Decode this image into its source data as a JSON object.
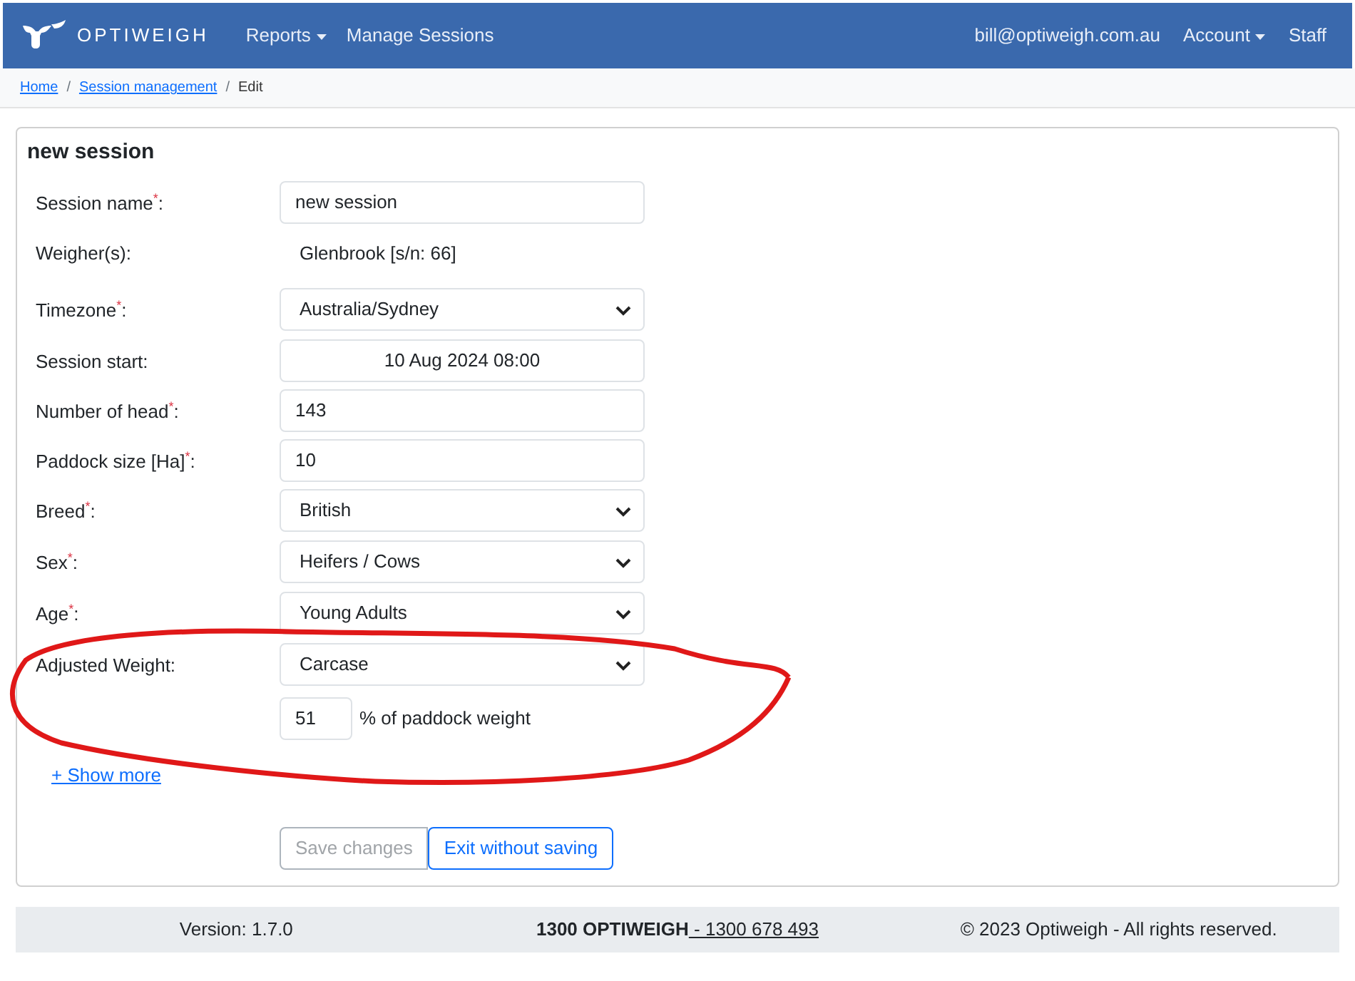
{
  "navbar": {
    "brand": "OPTIWEIGH",
    "left": [
      {
        "label": "Reports",
        "dropdown": true
      },
      {
        "label": "Manage Sessions",
        "dropdown": false
      }
    ],
    "right": [
      {
        "label": "bill@optiweigh.com.au",
        "dropdown": false
      },
      {
        "label": "Account",
        "dropdown": true
      },
      {
        "label": "Staff",
        "dropdown": false
      }
    ]
  },
  "breadcrumb": [
    {
      "kind": "link",
      "label": "Home"
    },
    {
      "kind": "separator",
      "label": "/"
    },
    {
      "kind": "link",
      "label": "Session management"
    },
    {
      "kind": "separator",
      "label": "/"
    },
    {
      "kind": "current",
      "label": "Edit"
    }
  ],
  "card": {
    "title": "new session",
    "fields": [
      {
        "kind": "text",
        "label": "Session name$^{*}$:",
        "value": "new session"
      },
      {
        "kind": "static",
        "label": "Weigher(s):",
        "value": "Glenbrook [s/n: 66]"
      },
      {
        "kind": "select",
        "label": "Timezone$^{*}$:",
        "value": "Australia/Sydney"
      },
      {
        "kind": "date",
        "label": "Session start:",
        "value": "10 Aug 2024 08:00"
      },
      {
        "kind": "text",
        "label": "Number of head$^{*}$:",
        "value": "143"
      },
      {
        "kind": "text",
        "label": "Paddock size [Ha]$^{*}$:",
        "value": "10"
      },
      {
        "kind": "select",
        "label": "Breed$^{*}$:",
        "value": "British"
      },
      {
        "kind": "select",
        "label": "Sex$^{*}$:",
        "value": "Heifers / Cows"
      },
      {
        "kind": "select",
        "label": "Age$^{*}$:",
        "value": "Young Adults"
      },
      {
        "kind": "select",
        "label": "Adjusted Weight:",
        "value": "Carcase"
      },
      {
        "kind": "percent",
        "value": "51",
        "suffix": "% of paddock weight"
      }
    ],
    "show_more": "+ Show more",
    "buttons": [
      {
        "label": "Save changes",
        "disabled": true
      },
      {
        "label": "Exit without saving",
        "disabled": false
      }
    ]
  },
  "footer": {
    "version": "Version: 1.7.0",
    "phone_name": "1300 OPTIWEIGH",
    "phone_number": " - 1300 678 493",
    "copyright": "© 2023 Optiweigh - All rights reserved."
  }
}
